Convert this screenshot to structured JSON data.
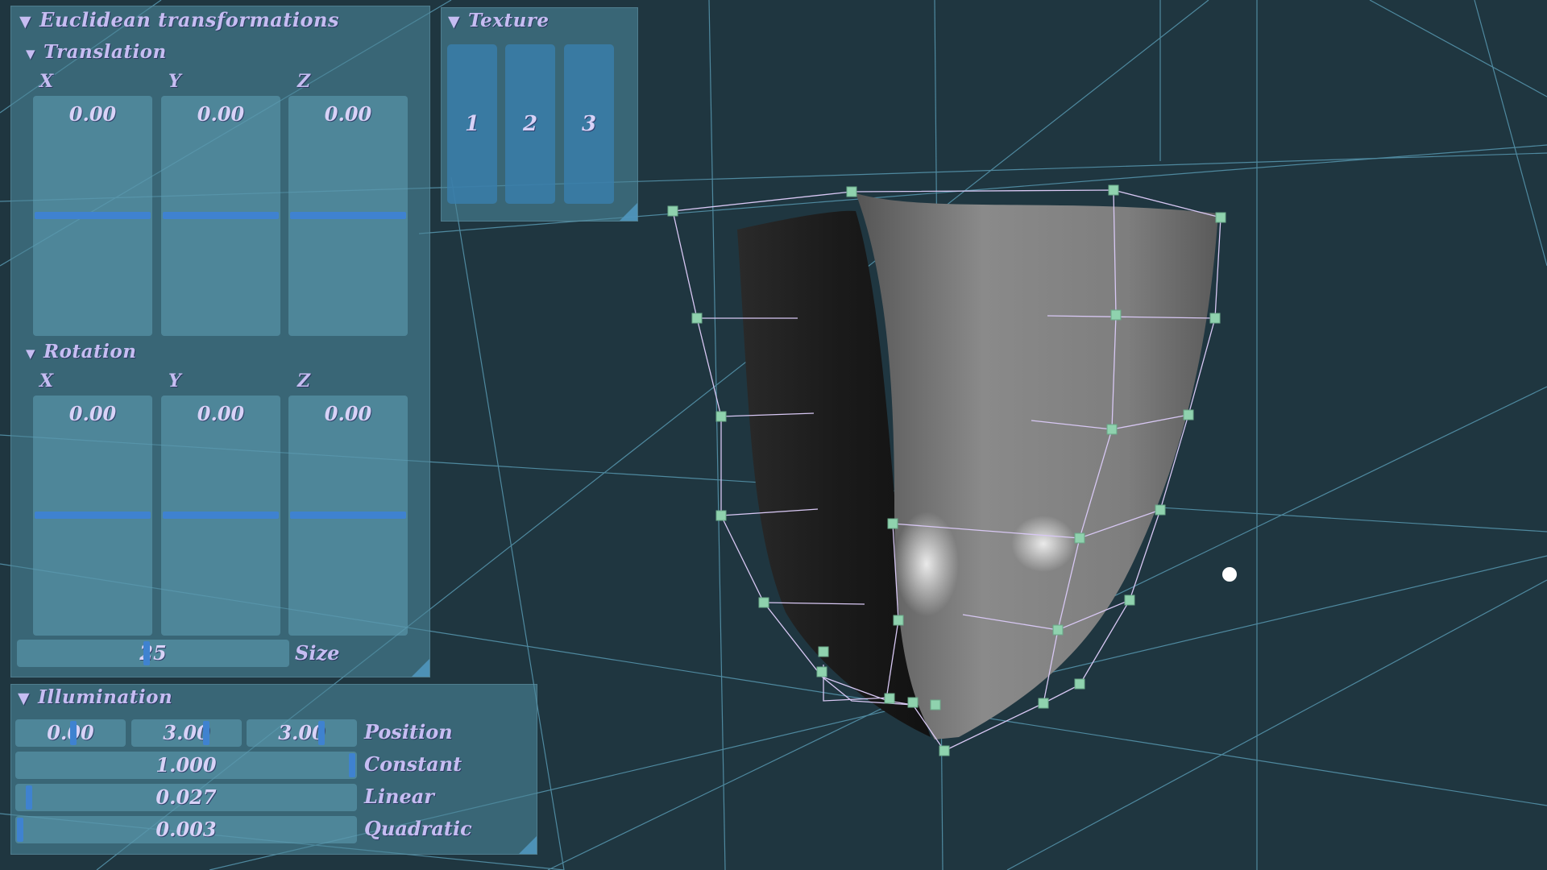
{
  "colors": {
    "background": "#1f3640",
    "panel": "#4a8498",
    "label_text": "#c6bdf2",
    "slider_handle": "#3f82d0",
    "control_point": "#8fd2ae",
    "control_polygon": "#d8c8f4",
    "grid_line": "#5fa5bf"
  },
  "euclidean": {
    "title": "Euclidean transformations",
    "translation": {
      "title": "Translation",
      "axes": [
        "X",
        "Y",
        "Z"
      ],
      "values": [
        "0.00",
        "0.00",
        "0.00"
      ]
    },
    "rotation": {
      "title": "Rotation",
      "axes": [
        "X",
        "Y",
        "Z"
      ],
      "values": [
        "0.00",
        "0.00",
        "0.00"
      ]
    },
    "size": {
      "value": "25",
      "label": "Size"
    }
  },
  "texture": {
    "title": "Texture",
    "buttons": [
      "1",
      "2",
      "3"
    ]
  },
  "illumination": {
    "title": "Illumination",
    "position": {
      "values": [
        "0.00",
        "3.00",
        "3.00"
      ],
      "label": "Position"
    },
    "constant": {
      "value": "1.000",
      "label": "Constant"
    },
    "linear": {
      "value": "0.027",
      "label": "Linear"
    },
    "quadratic": {
      "value": "0.003",
      "label": "Quadratic"
    }
  },
  "icons": {
    "collapse": "triangle-down-icon"
  }
}
